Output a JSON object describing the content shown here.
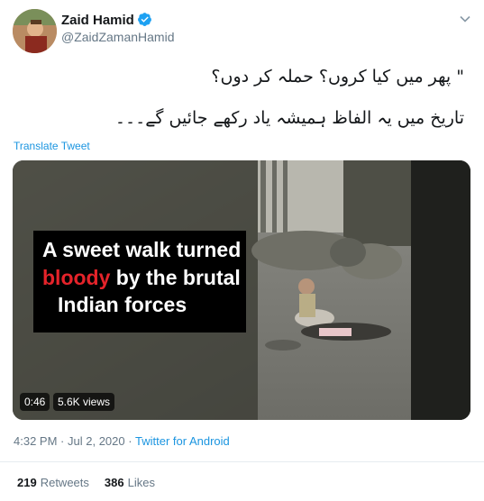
{
  "author": {
    "display_name": "Zaid Hamid",
    "handle": "@ZaidZamanHamid"
  },
  "tweet": {
    "text_line_1": "\" پھر میں کیا کروں؟ حملہ کر دوں؟",
    "text_line_2": "تاریخ میں یہ الفاظ ہمیشہ یاد رکھے جائیں گے۔۔۔",
    "translate_label": "Translate Tweet"
  },
  "media": {
    "overlay_line_1": "A sweet walk turned",
    "overlay_word_red": "bloody",
    "overlay_line_2_rest": " by the brutal",
    "overlay_line_3": "Indian forces",
    "duration": "0:46",
    "views": "5.6K views"
  },
  "meta": {
    "time": "4:32 PM",
    "separator": "·",
    "date": "Jul 2, 2020",
    "source": "Twitter for Android"
  },
  "stats": {
    "retweets_count": "219",
    "retweets_label": "Retweets",
    "likes_count": "386",
    "likes_label": "Likes"
  },
  "colors": {
    "link": "#1b95e0",
    "muted": "#657786",
    "overlay_red": "#e5232a"
  }
}
